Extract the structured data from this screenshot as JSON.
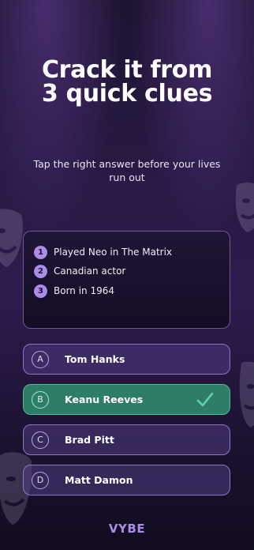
{
  "hero": {
    "title_line1": "Crack it from",
    "title_line2": "3 quick clues",
    "subtitle": "Tap the right answer before your lives run out"
  },
  "clues": [
    {
      "number": "1",
      "text": "Played Neo in The Matrix"
    },
    {
      "number": "2",
      "text": "Canadian actor"
    },
    {
      "number": "3",
      "text": "Born in 1964"
    }
  ],
  "options": [
    {
      "letter": "A",
      "label": "Tom Hanks",
      "correct": false
    },
    {
      "letter": "B",
      "label": "Keanu Reeves",
      "correct": true
    },
    {
      "letter": "C",
      "label": "Brad Pitt",
      "correct": false
    },
    {
      "letter": "D",
      "label": "Matt Damon",
      "correct": false
    }
  ],
  "brand": "VYBE",
  "icons": {
    "correct": "checkmark-icon",
    "decoration": "theater-mask-icon"
  },
  "colors": {
    "accent": "#a98de6",
    "correct_bg": "#2e7d67",
    "correct_check": "#5fd3a8"
  }
}
